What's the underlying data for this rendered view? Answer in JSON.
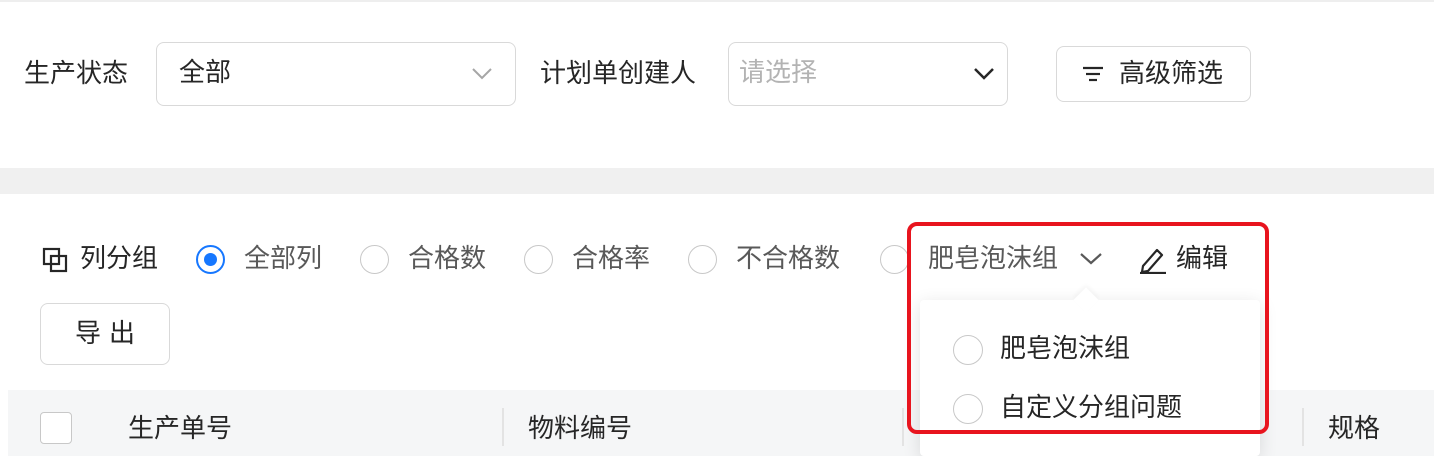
{
  "filters": {
    "status_label": "生产状态",
    "status_value": "全部",
    "creator_label": "计划单创建人",
    "creator_placeholder": "请选择",
    "advanced_label": "高级筛选"
  },
  "column_group": {
    "label": "列分组",
    "options": [
      {
        "label": "全部列",
        "checked": true
      },
      {
        "label": "合格数",
        "checked": false
      },
      {
        "label": "合格率",
        "checked": false
      },
      {
        "label": "不合格数",
        "checked": false
      }
    ],
    "dropdown_value": "肥皂泡沫组",
    "edit_label": "编辑"
  },
  "export_label": "导出",
  "popover": {
    "items": [
      {
        "label": "肥皂泡沫组",
        "checked": false
      },
      {
        "label": "自定义分组问题",
        "checked": false
      }
    ]
  },
  "table": {
    "columns": [
      "生产单号",
      "物料编号",
      "规格"
    ]
  },
  "colors": {
    "accent": "#1677ff",
    "highlight": "#e8141e"
  },
  "icons": [
    "chevron-down-icon",
    "filter-icon",
    "column-group-icon",
    "edit-icon"
  ]
}
